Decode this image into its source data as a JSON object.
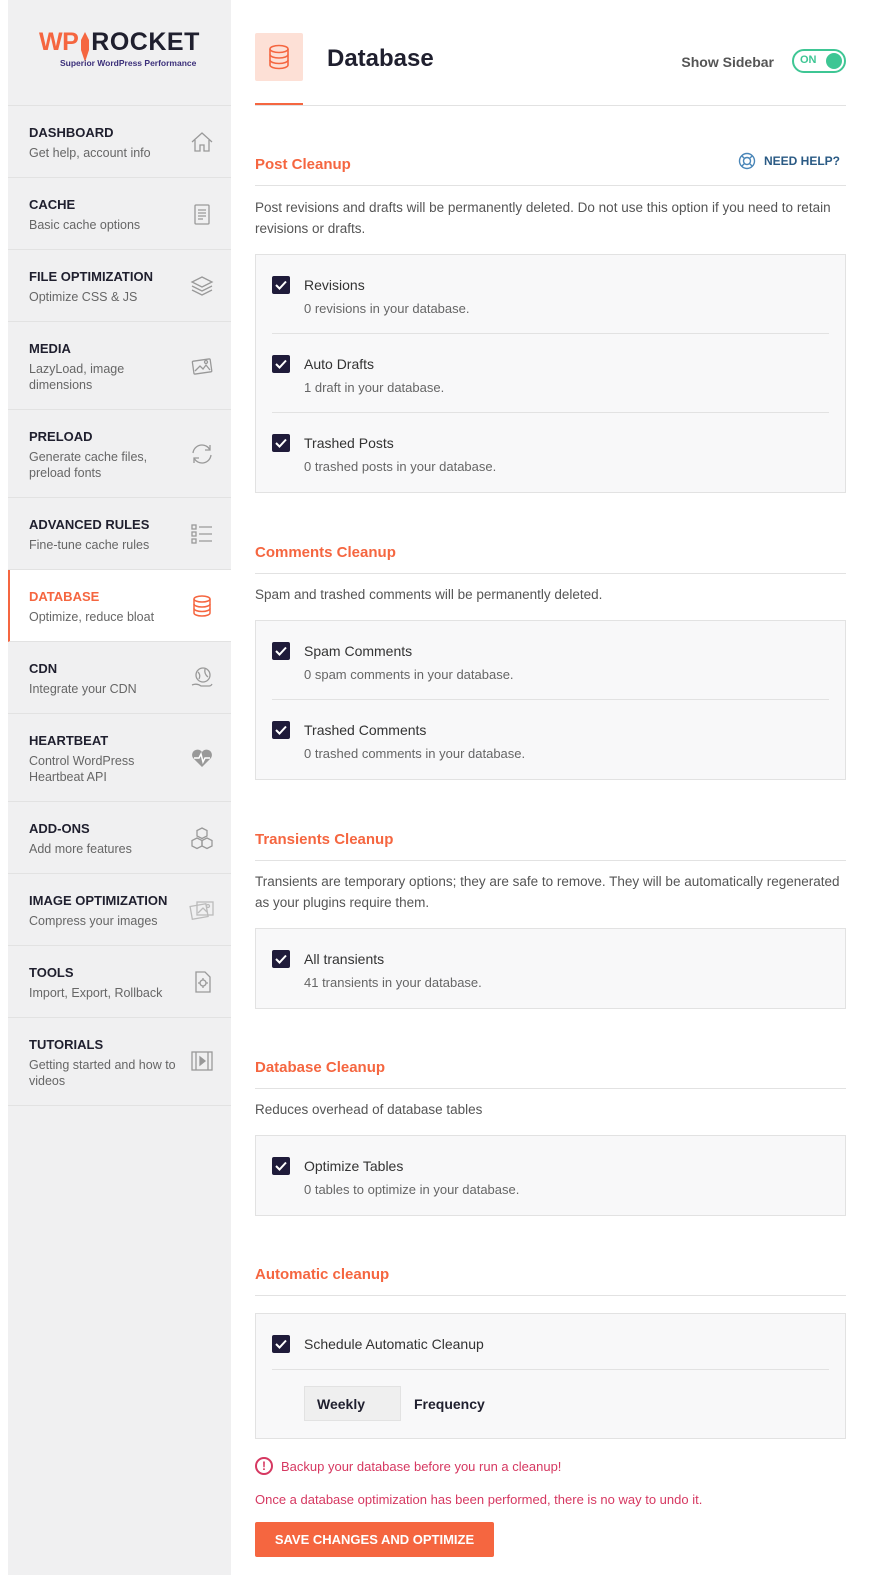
{
  "logo": {
    "wp": "WP",
    "rocket": "ROCKET",
    "tagline": "Superior WordPress Performance"
  },
  "sidebar": {
    "items": [
      {
        "title": "DASHBOARD",
        "desc": "Get help, account info",
        "icon": "home-icon"
      },
      {
        "title": "CACHE",
        "desc": "Basic cache options",
        "icon": "document-icon"
      },
      {
        "title": "FILE OPTIMIZATION",
        "desc": "Optimize CSS & JS",
        "icon": "layers-icon"
      },
      {
        "title": "MEDIA",
        "desc": "LazyLoad, image dimensions",
        "icon": "images-icon"
      },
      {
        "title": "PRELOAD",
        "desc": "Generate cache files, preload fonts",
        "icon": "refresh-icon"
      },
      {
        "title": "ADVANCED RULES",
        "desc": "Fine-tune cache rules",
        "icon": "checklist-icon"
      },
      {
        "title": "DATABASE",
        "desc": "Optimize, reduce bloat",
        "icon": "database-icon",
        "active": true
      },
      {
        "title": "CDN",
        "desc": "Integrate your CDN",
        "icon": "globe-hand-icon"
      },
      {
        "title": "HEARTBEAT",
        "desc": "Control WordPress Heartbeat API",
        "icon": "heartbeat-icon"
      },
      {
        "title": "ADD-ONS",
        "desc": "Add more features",
        "icon": "cubes-icon"
      },
      {
        "title": "IMAGE OPTIMIZATION",
        "desc": "Compress your images",
        "icon": "image-compress-icon"
      },
      {
        "title": "TOOLS",
        "desc": "Import, Export, Rollback",
        "icon": "gear-doc-icon"
      },
      {
        "title": "TUTORIALS",
        "desc": "Getting started and how to videos",
        "icon": "video-icon"
      }
    ]
  },
  "header": {
    "title": "Database",
    "show_sidebar": "Show Sidebar",
    "toggle": "ON"
  },
  "need_help": "NEED HELP?",
  "sections": {
    "post": {
      "title": "Post Cleanup",
      "desc": "Post revisions and drafts will be permanently deleted. Do not use this option if you need to retain revisions or drafts.",
      "options": [
        {
          "label": "Revisions",
          "sub": "0 revisions in your database."
        },
        {
          "label": "Auto Drafts",
          "sub": "1 draft in your database."
        },
        {
          "label": "Trashed Posts",
          "sub": "0 trashed posts in your database."
        }
      ]
    },
    "comments": {
      "title": "Comments Cleanup",
      "desc": "Spam and trashed comments will be permanently deleted.",
      "options": [
        {
          "label": "Spam Comments",
          "sub": "0 spam comments in your database."
        },
        {
          "label": "Trashed Comments",
          "sub": "0 trashed comments in your database."
        }
      ]
    },
    "transients": {
      "title": "Transients Cleanup",
      "desc": "Transients are temporary options; they are safe to remove. They will be automatically regenerated as your plugins require them.",
      "options": [
        {
          "label": "All transients",
          "sub": "41 transients in your database."
        }
      ]
    },
    "database": {
      "title": "Database Cleanup",
      "desc": "Reduces overhead of database tables",
      "options": [
        {
          "label": "Optimize Tables",
          "sub": "0 tables to optimize in your database."
        }
      ]
    },
    "automatic": {
      "title": "Automatic cleanup",
      "options": [
        {
          "label": "Schedule Automatic Cleanup"
        }
      ],
      "frequency_value": "Weekly",
      "frequency_label": "Frequency"
    }
  },
  "warning": "Backup your database before you run a cleanup!",
  "warning2": "Once a database optimization has been performed, there is no way to undo it.",
  "save_button": "SAVE CHANGES AND OPTIMIZE",
  "colors": {
    "accent": "#f56640",
    "toggle": "#3ec694",
    "warning": "#d63861",
    "checkbox": "#1f1b3a"
  }
}
